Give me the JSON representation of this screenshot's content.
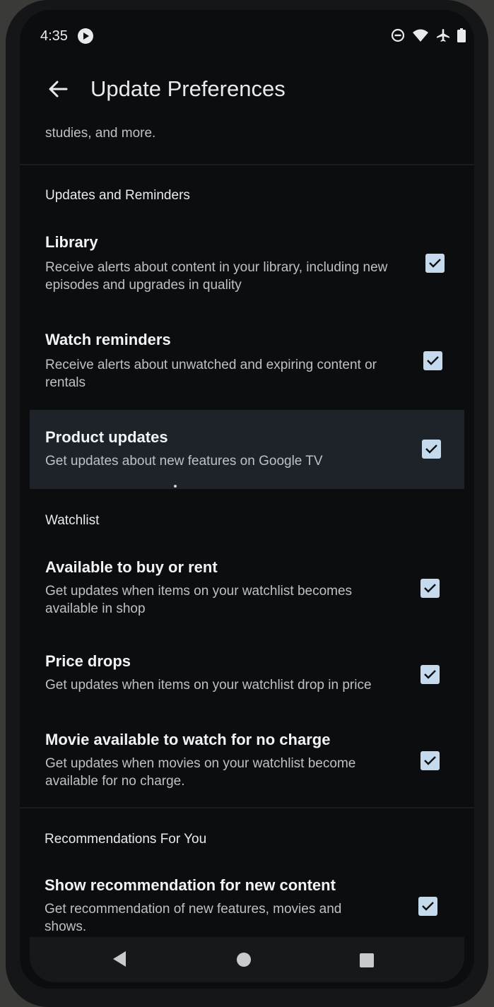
{
  "status_bar": {
    "time": "4:35",
    "icons": [
      "app-notification-icon",
      "do-not-disturb-icon",
      "wifi-icon",
      "airplane-icon",
      "battery-icon"
    ]
  },
  "app_bar": {
    "title": "Update Preferences",
    "back_icon": "arrow-back-icon"
  },
  "intro_text": "studies, and more.",
  "sections": [
    {
      "header": "Updates and Reminders",
      "items": [
        {
          "title": "Library",
          "description": "Receive alerts about content in your library, including new episodes and upgrades in quality",
          "checked": true
        },
        {
          "title": "Watch reminders",
          "description": "Receive alerts about unwatched and expiring content or rentals",
          "checked": true
        },
        {
          "title": "Product updates",
          "description": "Get updates about new features on Google TV",
          "checked": true
        }
      ]
    },
    {
      "header": "Watchlist",
      "items": [
        {
          "title": "Available to buy or rent",
          "description": "Get updates when items on your watchlist becomes available in shop",
          "checked": true
        },
        {
          "title": "Price drops",
          "description": "Get updates when items on your watchlist drop in price",
          "checked": true
        },
        {
          "title": "Movie available to watch for no charge",
          "description": "Get updates when movies on your watchlist become available for no charge.",
          "checked": true
        }
      ]
    },
    {
      "header": "Recommendations For You",
      "items": [
        {
          "title": "Show recommendation for new content",
          "description": "Get recommendation of new features, movies and shows.",
          "checked": true
        }
      ]
    }
  ],
  "colors": {
    "background": "#0c0d0f",
    "highlight_row": "#1e2329",
    "checkbox": "#c5dbed",
    "text_primary": "#f1f3f4",
    "text_secondary": "#bdc1c6"
  },
  "nav_bar": {
    "icons": [
      "nav-back-icon",
      "nav-home-icon",
      "nav-recents-icon"
    ]
  }
}
